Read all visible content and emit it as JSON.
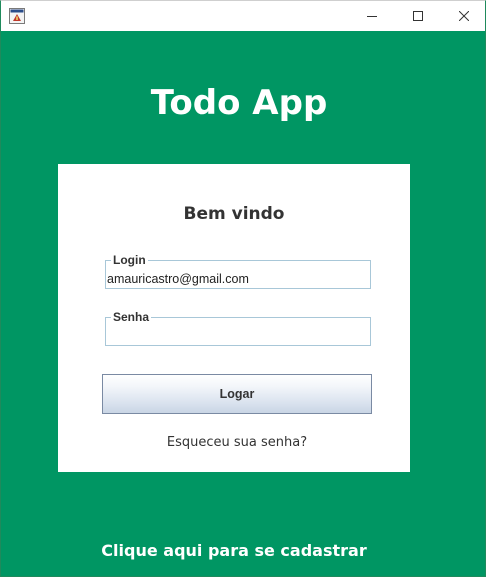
{
  "window": {
    "app_icon": "java-app-icon",
    "controls": {
      "minimize_icon": "minimize-icon",
      "maximize_icon": "maximize-icon",
      "close_icon": "close-icon"
    }
  },
  "header": {
    "title": "Todo App"
  },
  "card": {
    "welcome": "Bem vindo",
    "login": {
      "label": "Login",
      "value": "amauricastro@gmail.com"
    },
    "senha": {
      "label": "Senha",
      "value": ""
    },
    "submit_label": "Logar",
    "forgot_label": "Esqueceu sua senha?"
  },
  "footer": {
    "register_label": "Clique aqui para se cadastrar"
  },
  "colors": {
    "background_green": "#009663",
    "card_bg": "#ffffff",
    "field_border": "#a8c7d8",
    "button_border": "#7a8aa3",
    "text_dark": "#333333",
    "text_light": "#ffffff"
  }
}
